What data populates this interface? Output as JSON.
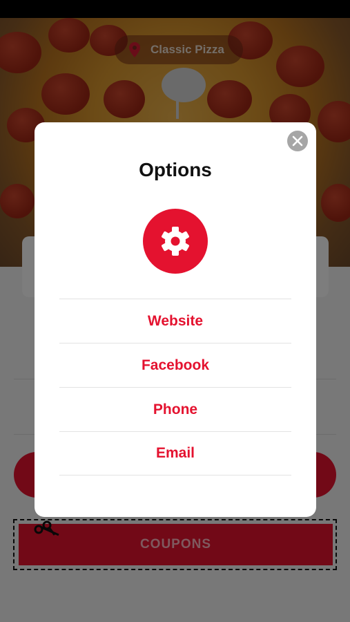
{
  "header": {
    "location_label": "Classic Pizza",
    "location_icon": "map-pin-icon"
  },
  "modal": {
    "title": "Options",
    "header_icon": "gear-icon",
    "close_icon": "close-icon",
    "items": [
      {
        "label": "Website"
      },
      {
        "label": "Facebook"
      },
      {
        "label": "Phone"
      },
      {
        "label": "Email"
      }
    ]
  },
  "page": {
    "coupons_label": "COUPONS",
    "coupons_icon": "scissors-icon"
  },
  "colors": {
    "accent": "#e4122f",
    "close_button": "#a6a6a6",
    "modal_background": "#ffffff"
  }
}
